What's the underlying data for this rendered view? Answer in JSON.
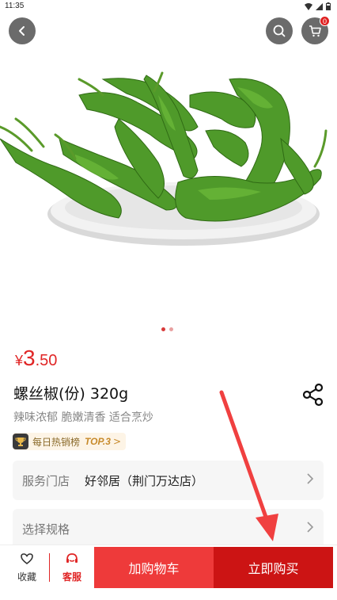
{
  "status_bar": {
    "time": "11:35"
  },
  "header": {
    "back_icon": "back-arrow-icon",
    "search_icon": "search-icon",
    "cart_icon": "cart-icon",
    "cart_badge": "0"
  },
  "gallery": {
    "dots": 2,
    "active_index": 0
  },
  "product": {
    "price_symbol": "¥",
    "price_int": "3",
    "price_dec": ".50",
    "title": "螺丝椒(份) 320g",
    "subtitle": "辣味浓郁 脆嫩清香 适合烹炒",
    "rank_label": "每日热销榜",
    "rank_top": "TOP.3",
    "rank_chevron": ">"
  },
  "store": {
    "label": "服务门店",
    "value": "好邻居（荆门万达店）"
  },
  "spec": {
    "label": "选择规格"
  },
  "bottom": {
    "fav_label": "收藏",
    "service_label": "客服",
    "add_cart": "加购物车",
    "buy_now": "立即购买"
  },
  "colors": {
    "accent": "#e02626",
    "buy": "#cc1414",
    "add_cart": "#ee3a3a",
    "icon_bg": "#6b6b6b"
  }
}
